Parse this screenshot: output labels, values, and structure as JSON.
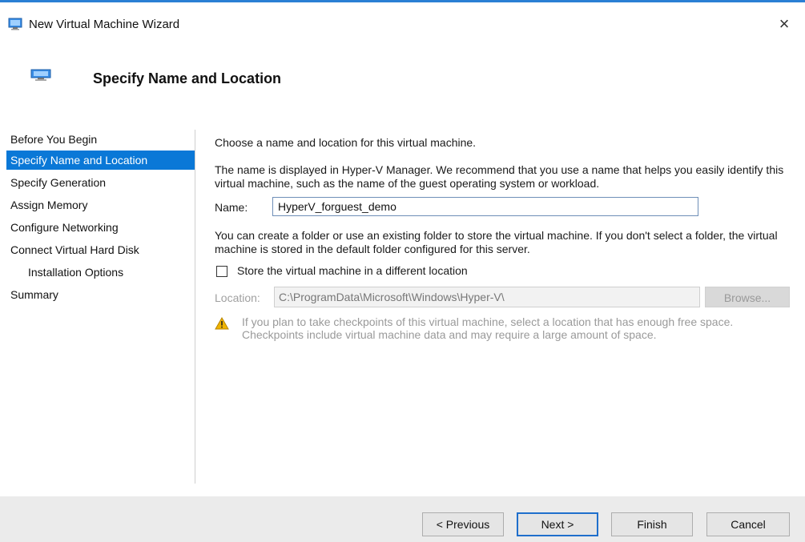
{
  "window": {
    "title": "New Virtual Machine Wizard",
    "close_glyph": "×"
  },
  "header": {
    "title": "Specify Name and Location"
  },
  "sidebar": {
    "items": [
      {
        "label": "Before You Begin"
      },
      {
        "label": "Specify Name and Location",
        "active": true
      },
      {
        "label": "Specify Generation"
      },
      {
        "label": "Assign Memory"
      },
      {
        "label": "Configure Networking"
      },
      {
        "label": "Connect Virtual Hard Disk"
      },
      {
        "label": "Installation Options"
      },
      {
        "label": "Summary"
      }
    ]
  },
  "content": {
    "intro": "Choose a name and location for this virtual machine.",
    "description": "The name is displayed in Hyper-V Manager. We recommend that you use a name that helps you easily identify this virtual machine, such as the name of the guest operating system or workload.",
    "name_label": "Name:",
    "name_value": "HyperV_forguest_demo",
    "folder_text": "You can create a folder or use an existing folder to store the virtual machine. If you don't select a folder, the virtual machine is stored in the default folder configured for this server.",
    "checkbox_label": "Store the virtual machine in a different location",
    "checkbox_checked": false,
    "location_label": "Location:",
    "location_value": "C:\\ProgramData\\Microsoft\\Windows\\Hyper-V\\",
    "browse_label": "Browse...",
    "warning_text": "If you plan to take checkpoints of this virtual machine, select a location that has enough free space. Checkpoints include virtual machine data and may require a large amount of space."
  },
  "footer": {
    "previous": "< Previous",
    "next": "Next >",
    "finish": "Finish",
    "cancel": "Cancel"
  },
  "colors": {
    "accent": "#0a78d7",
    "warning": "#f0b400"
  }
}
